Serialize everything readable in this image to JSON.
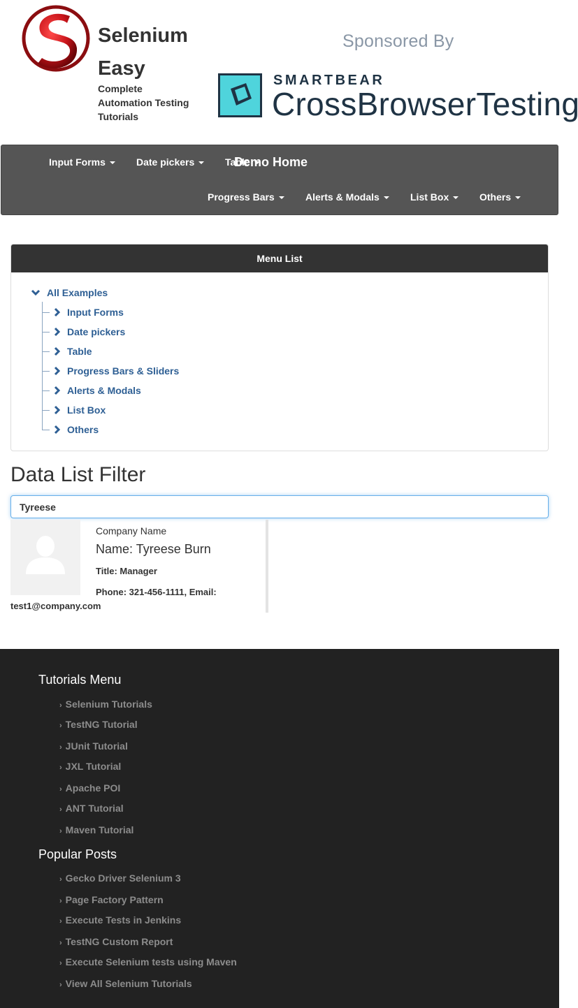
{
  "header": {
    "brand_line1": "Selenium",
    "brand_line2": "Easy",
    "tagline_line1": "Complete",
    "tagline_line2": "Automation Testing",
    "tagline_line3": "Tutorials",
    "sponsored_by": "Sponsored By",
    "sponsor_company": "SMARTBEAR",
    "sponsor_product": "CrossBrowserTesting",
    "colors": {
      "logo_red": "#c8141a",
      "sponsor_teal": "#4fd4dc",
      "sponsor_navy": "#1f3344"
    }
  },
  "navbar": {
    "items_row1": [
      "Input Forms",
      "Date pickers",
      "Table"
    ],
    "demo_home": "Demo Home",
    "items_row2": [
      "Progress Bars",
      "Alerts & Modals",
      "List Box",
      "Others"
    ],
    "colors": {
      "background": "#555555",
      "text": "#ffffff"
    }
  },
  "menu_list": {
    "title": "Menu List",
    "root": "All Examples",
    "items": [
      "Input Forms",
      "Date pickers",
      "Table",
      "Progress Bars & Sliders",
      "Alerts & Modals",
      "List Box",
      "Others"
    ],
    "colors": {
      "link": "#2e5f94",
      "header_bg": "#333333"
    }
  },
  "filter": {
    "title": "Data List Filter",
    "search_value": "Tyreese",
    "result": {
      "company": "Company Name",
      "name": "Name: Tyreese Burn",
      "title": "Title: Manager",
      "phone": "Phone: 321-456-1111, Email:",
      "email": "test1@company.com"
    }
  },
  "footer": {
    "tutorials_heading": "Tutorials Menu",
    "tutorials": [
      "Selenium Tutorials",
      "TestNG Tutorial",
      "JUnit Tutorial",
      "JXL Tutorial",
      "Apache POI",
      "ANT Tutorial",
      "Maven Tutorial"
    ],
    "popular_heading": "Popular Posts",
    "popular": [
      "Gecko Driver Selenium 3",
      "Page Factory Pattern",
      "Execute Tests in Jenkins",
      "TestNG Custom Report",
      "Execute Selenium tests using Maven",
      "View All Selenium Tutorials"
    ],
    "colors": {
      "background": "#222222",
      "link": "#8c8c8c"
    }
  }
}
